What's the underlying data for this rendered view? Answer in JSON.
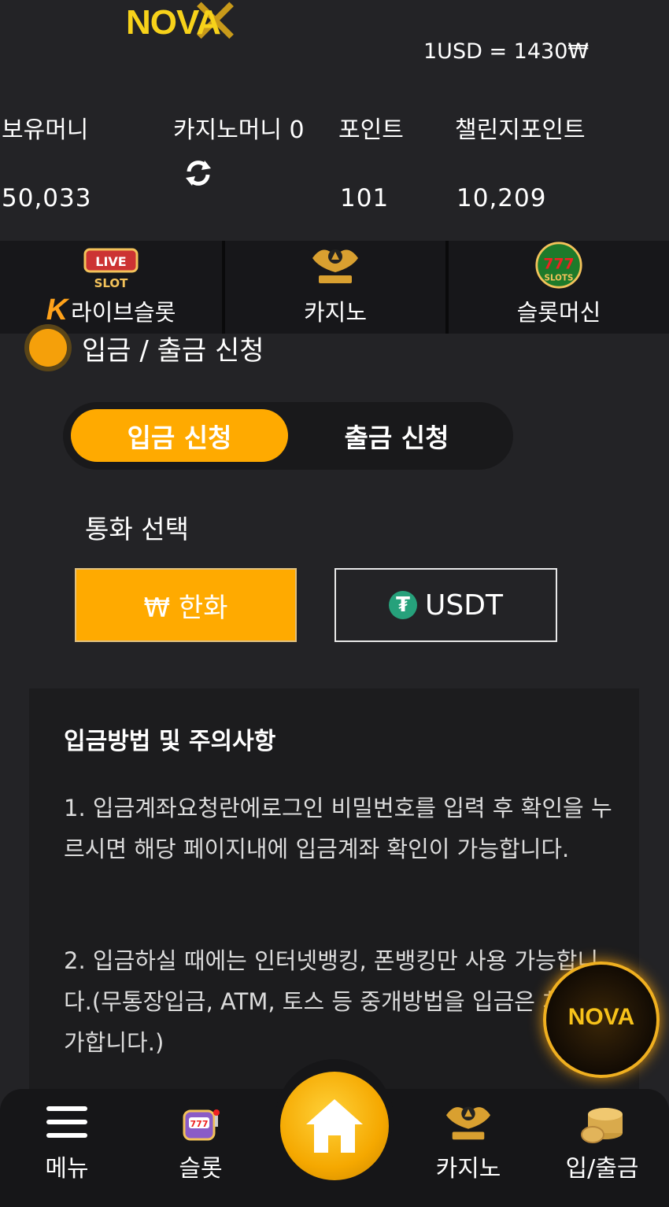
{
  "header": {
    "logo_text": "NOVA",
    "rate": "1USD = 1430₩"
  },
  "balances": {
    "items": [
      {
        "label": "보유머니",
        "value": "50,033"
      },
      {
        "label": "카지노머니 0",
        "value": ""
      },
      {
        "label": "포인트",
        "value": "101"
      },
      {
        "label": "챌린지포인트",
        "value": "10,209"
      }
    ]
  },
  "game_nav": [
    {
      "label": "라이브슬롯",
      "icon": "live-slot-icon"
    },
    {
      "label": "카지노",
      "icon": "kslot-crown-icon"
    },
    {
      "label": "슬롯머신",
      "icon": "777-slots-icon"
    }
  ],
  "section": {
    "title": "입금 / 출금 신청"
  },
  "tabs": {
    "deposit": "입금 신청",
    "withdraw": "출금 신청"
  },
  "currency": {
    "label": "통화 선택",
    "krw": "₩ 한화",
    "usdt": "USDT"
  },
  "notice": {
    "title": "입금방법 및 주의사항",
    "p1": "1. 입금계좌요청란에로그인 비밀번호를 입력 후 확인을 누르시면 해당 페이지내에 입금계좌 확인이 가능합니다.",
    "p2": "2. 입금하실 때에는 인터넷뱅킹, 폰뱅킹만 사용 가능합니다.(무통장입금, ATM, 토스 등 중개방법을 입금은 처리 불가합니다.)"
  },
  "fab": {
    "text": "NOVA"
  },
  "bottom_nav": [
    {
      "label": "메뉴",
      "icon": "menu-icon"
    },
    {
      "label": "슬롯",
      "icon": "slot-machine-icon"
    },
    {
      "label": "",
      "icon": "home-icon"
    },
    {
      "label": "카지노",
      "icon": "kslot-crown-icon"
    },
    {
      "label": "입/출금",
      "icon": "coins-icon"
    }
  ],
  "colors": {
    "accent": "#ffaa00",
    "background": "#232326",
    "tether": "#26a17b"
  }
}
